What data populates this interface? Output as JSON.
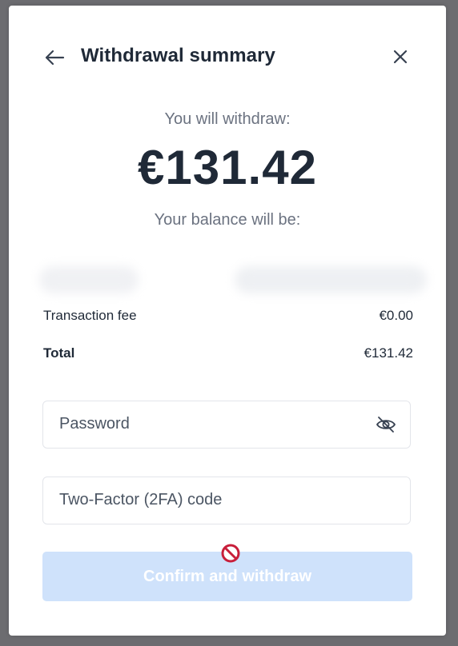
{
  "header": {
    "title": "Withdrawal summary"
  },
  "summary": {
    "withdraw_label": "You will withdraw:",
    "amount": "€131.42",
    "balance_label": "Your balance will be:"
  },
  "details": [
    {
      "label": "Transaction fee",
      "value": "€0.00"
    },
    {
      "label": "Total",
      "value": "€131.42"
    }
  ],
  "form": {
    "password_placeholder": "Password",
    "tfa_placeholder": "Two-Factor (2FA) code"
  },
  "actions": {
    "confirm_label": "Confirm and withdraw",
    "confirm_disabled": true
  },
  "colors": {
    "button_disabled_bg": "#cfe2fb",
    "text_primary": "#1f2937",
    "text_muted": "#6b7280",
    "blocked_icon": "#c81e3a"
  },
  "icons": [
    "arrow-left-icon",
    "close-icon",
    "eye-off-icon",
    "not-allowed-icon"
  ]
}
